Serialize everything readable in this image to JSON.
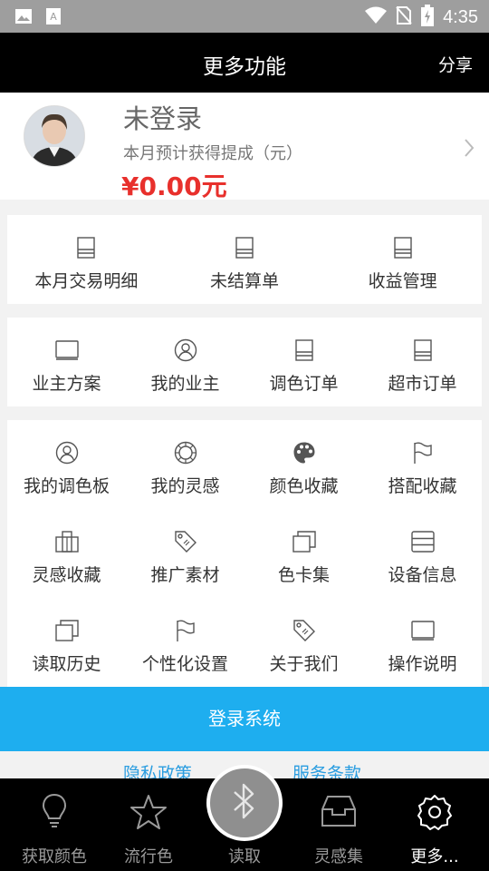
{
  "status_bar": {
    "time": "4:35"
  },
  "header": {
    "title": "更多功能",
    "share_label": "分享"
  },
  "profile": {
    "name": "未登录",
    "subtitle": "本月预计获得提成（元）",
    "amount": "¥0.00元"
  },
  "group1": [
    {
      "label": "本月交易明细",
      "icon": "list-icon"
    },
    {
      "label": "未结算单",
      "icon": "list-icon"
    },
    {
      "label": "收益管理",
      "icon": "list-icon"
    }
  ],
  "group2": [
    {
      "label": "业主方案",
      "icon": "laptop-icon"
    },
    {
      "label": "我的业主",
      "icon": "user-icon"
    },
    {
      "label": "调色订单",
      "icon": "list-icon"
    },
    {
      "label": "超市订单",
      "icon": "list-icon"
    }
  ],
  "group3": [
    {
      "label": "我的调色板",
      "icon": "user-icon"
    },
    {
      "label": "我的灵感",
      "icon": "aperture-icon"
    },
    {
      "label": "颜色收藏",
      "icon": "palette-icon"
    },
    {
      "label": "搭配收藏",
      "icon": "flag-icon"
    },
    {
      "label": "灵感收藏",
      "icon": "building-icon"
    },
    {
      "label": "推广素材",
      "icon": "tag-icon"
    },
    {
      "label": "色卡集",
      "icon": "copy-icon"
    },
    {
      "label": "设备信息",
      "icon": "layers-icon"
    },
    {
      "label": "读取历史",
      "icon": "copy-icon"
    },
    {
      "label": "个性化设置",
      "icon": "flag-icon"
    },
    {
      "label": "关于我们",
      "icon": "tag-icon"
    },
    {
      "label": "操作说明",
      "icon": "laptop-icon"
    }
  ],
  "login_button": "登录系统",
  "links": {
    "privacy": "隐私政策",
    "terms": "服务条款"
  },
  "tabs": [
    {
      "label": "获取颜色",
      "icon": "bulb-icon"
    },
    {
      "label": "流行色",
      "icon": "star-icon"
    },
    {
      "label": "读取",
      "icon": "bluetooth-icon"
    },
    {
      "label": "灵感集",
      "icon": "inbox-icon"
    },
    {
      "label": "更多...",
      "icon": "gear-icon"
    }
  ],
  "colors": {
    "accent": "#1eaeef",
    "amount": "#e8302c",
    "link": "#2a9de0"
  }
}
